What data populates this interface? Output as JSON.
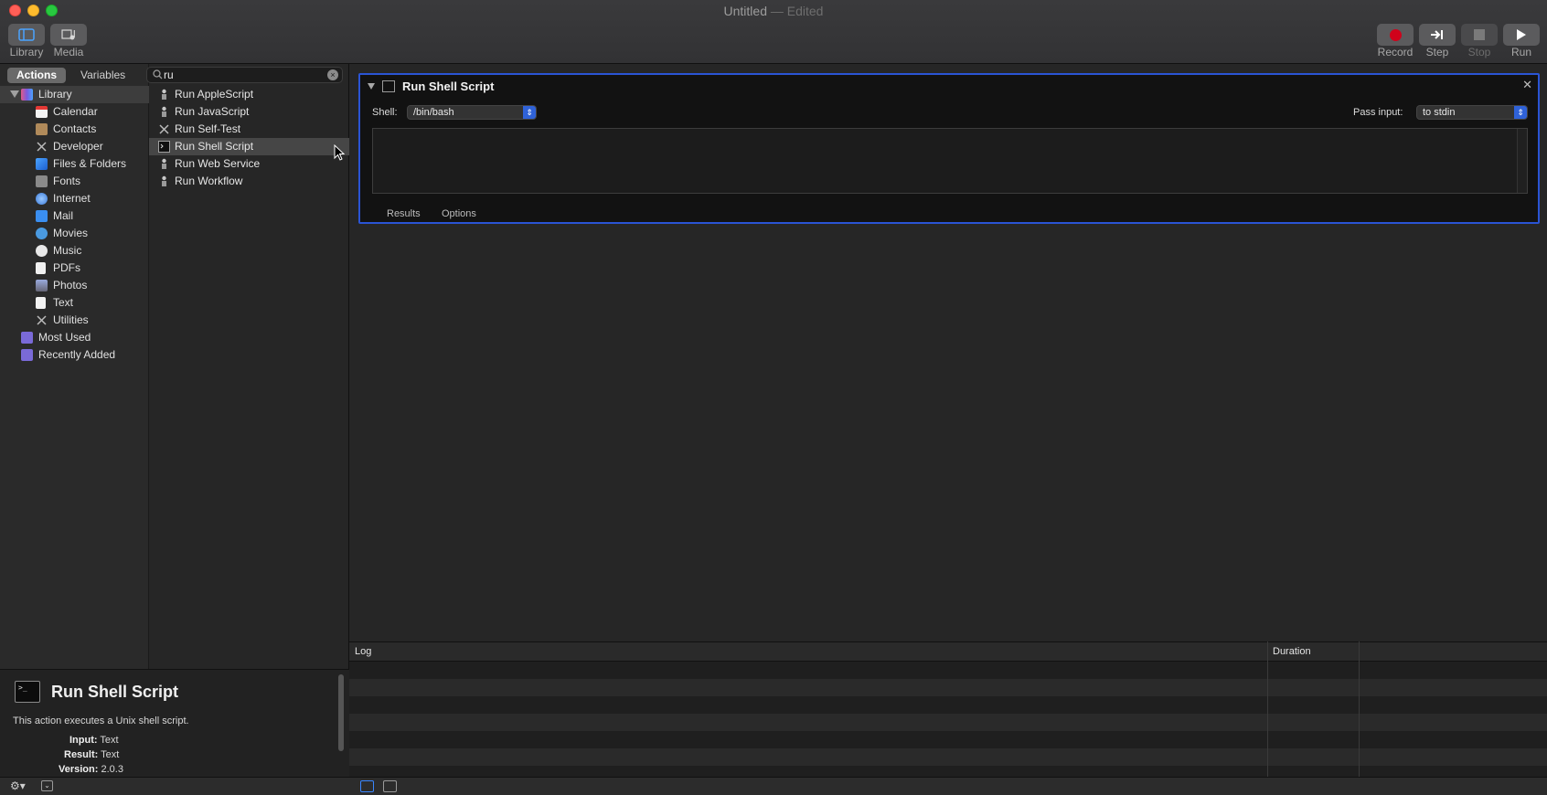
{
  "window": {
    "title": "Untitled",
    "edited": "— Edited"
  },
  "toolbar": {
    "library_label": "Library",
    "media_label": "Media",
    "record_label": "Record",
    "step_label": "Step",
    "stop_label": "Stop",
    "run_label": "Run"
  },
  "sidebar": {
    "tabs": [
      "Actions",
      "Variables"
    ],
    "active_tab": "Actions",
    "search": {
      "value": "ru"
    },
    "library_label": "Library",
    "categories": [
      {
        "label": "Calendar",
        "icon": "calendar-icon"
      },
      {
        "label": "Contacts",
        "icon": "contacts-icon"
      },
      {
        "label": "Developer",
        "icon": "developer-icon"
      },
      {
        "label": "Files & Folders",
        "icon": "files-folders-icon"
      },
      {
        "label": "Fonts",
        "icon": "fonts-icon"
      },
      {
        "label": "Internet",
        "icon": "internet-icon"
      },
      {
        "label": "Mail",
        "icon": "mail-icon"
      },
      {
        "label": "Movies",
        "icon": "movies-icon"
      },
      {
        "label": "Music",
        "icon": "music-icon"
      },
      {
        "label": "PDFs",
        "icon": "pdfs-icon"
      },
      {
        "label": "Photos",
        "icon": "photos-icon"
      },
      {
        "label": "Text",
        "icon": "text-icon"
      },
      {
        "label": "Utilities",
        "icon": "utilities-icon"
      }
    ],
    "smart_groups": [
      {
        "label": "Most Used",
        "icon": "smart-folder-icon"
      },
      {
        "label": "Recently Added",
        "icon": "smart-folder-icon"
      }
    ]
  },
  "actions": {
    "items": [
      {
        "label": "Run AppleScript",
        "icon": "automator-robot-icon"
      },
      {
        "label": "Run JavaScript",
        "icon": "automator-robot-icon"
      },
      {
        "label": "Run Self-Test",
        "icon": "tools-icon"
      },
      {
        "label": "Run Shell Script",
        "icon": "terminal-icon"
      },
      {
        "label": "Run Web Service",
        "icon": "automator-robot-icon"
      },
      {
        "label": "Run Workflow",
        "icon": "automator-robot-icon"
      }
    ],
    "selected": "Run Shell Script"
  },
  "description": {
    "title": "Run Shell Script",
    "text": "This action executes a Unix shell script.",
    "input_label": "Input:",
    "input_value": "Text",
    "result_label": "Result:",
    "result_value": "Text",
    "version_label": "Version:",
    "version_value": "2.0.3"
  },
  "action_card": {
    "title": "Run Shell Script",
    "shell_label": "Shell:",
    "shell_value": "/bin/bash",
    "pass_input_label": "Pass input:",
    "pass_input_value": "to stdin",
    "script_content": "",
    "tabs": [
      "Results",
      "Options"
    ]
  },
  "log": {
    "columns": [
      "Log",
      "Duration"
    ]
  },
  "colors": {
    "accent": "#2a54d4",
    "record": "#d0021b"
  }
}
